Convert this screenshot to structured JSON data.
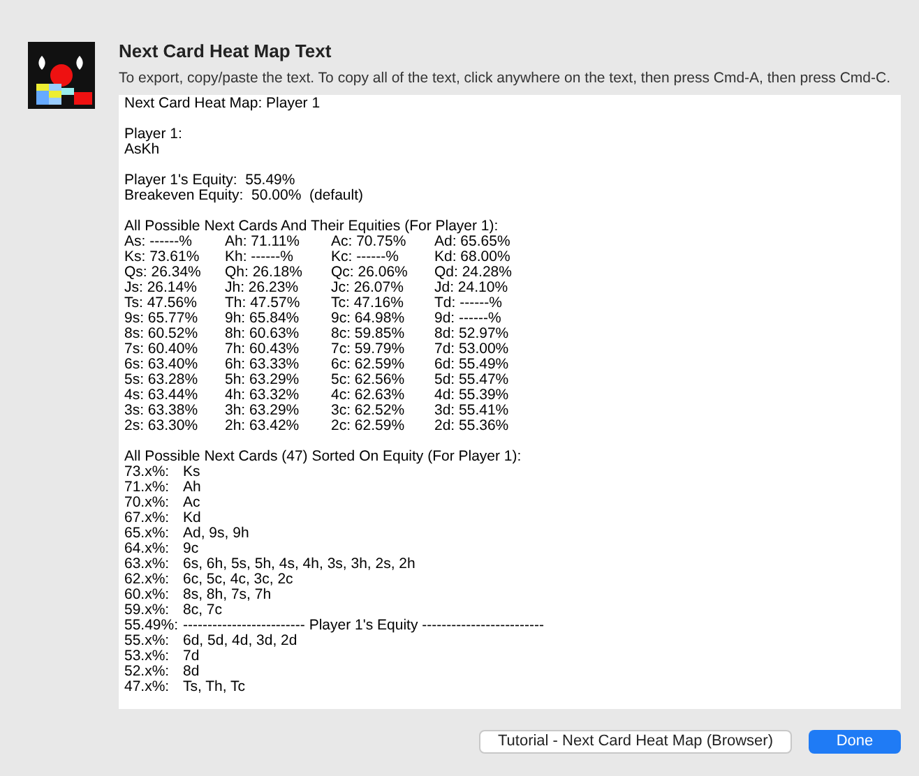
{
  "dialog": {
    "title": "Next Card Heat Map Text",
    "instructions": "To export, copy/paste the text. To copy all of the text, click anywhere on the text, then press Cmd-A, then press Cmd-C."
  },
  "report_lines": [
    {
      "kind": "text",
      "text": "Next Card Heat Map: Player 1"
    },
    {
      "kind": "blank"
    },
    {
      "kind": "text",
      "text": "Player 1:"
    },
    {
      "kind": "text",
      "text": "AsKh"
    },
    {
      "kind": "blank"
    },
    {
      "kind": "text",
      "text": "Player 1's Equity:  55.49%"
    },
    {
      "kind": "text",
      "text": "Breakeven Equity:  50.00%  (default)"
    },
    {
      "kind": "blank"
    },
    {
      "kind": "text",
      "text": "All Possible Next Cards And Their Equities (For Player 1):"
    },
    {
      "kind": "cells",
      "cells": [
        "As: ------%",
        "Ah: 71.11%",
        "Ac: 70.75%",
        "Ad: 65.65%"
      ]
    },
    {
      "kind": "cells",
      "cells": [
        "Ks: 73.61%",
        "Kh: ------%",
        "Kc: ------%",
        "Kd: 68.00%"
      ]
    },
    {
      "kind": "cells",
      "cells": [
        "Qs: 26.34%",
        "Qh: 26.18%",
        "Qc: 26.06%",
        "Qd: 24.28%"
      ]
    },
    {
      "kind": "cells",
      "cells": [
        "Js: 26.14%",
        "Jh: 26.23%",
        "Jc: 26.07%",
        "Jd: 24.10%"
      ]
    },
    {
      "kind": "cells",
      "cells": [
        "Ts: 47.56%",
        "Th: 47.57%",
        "Tc: 47.16%",
        "Td: ------%"
      ]
    },
    {
      "kind": "cells",
      "cells": [
        "9s: 65.77%",
        "9h: 65.84%",
        "9c: 64.98%",
        "9d: ------%"
      ]
    },
    {
      "kind": "cells",
      "cells": [
        "8s: 60.52%",
        "8h: 60.63%",
        "8c: 59.85%",
        "8d: 52.97%"
      ]
    },
    {
      "kind": "cells",
      "cells": [
        "7s: 60.40%",
        "7h: 60.43%",
        "7c: 59.79%",
        "7d: 53.00%"
      ]
    },
    {
      "kind": "cells",
      "cells": [
        "6s: 63.40%",
        "6h: 63.33%",
        "6c: 62.59%",
        "6d: 55.49%"
      ]
    },
    {
      "kind": "cells",
      "cells": [
        "5s: 63.28%",
        "5h: 63.29%",
        "5c: 62.56%",
        "5d: 55.47%"
      ]
    },
    {
      "kind": "cells",
      "cells": [
        "4s: 63.44%",
        "4h: 63.32%",
        "4c: 62.63%",
        "4d: 55.39%"
      ]
    },
    {
      "kind": "cells",
      "cells": [
        "3s: 63.38%",
        "3h: 63.29%",
        "3c: 62.52%",
        "3d: 55.41%"
      ]
    },
    {
      "kind": "cells",
      "cells": [
        "2s: 63.30%",
        "2h: 63.42%",
        "2c: 62.59%",
        "2d: 55.36%"
      ]
    },
    {
      "kind": "blank"
    },
    {
      "kind": "text",
      "text": "All Possible Next Cards (47) Sorted On Equity (For Player 1):"
    },
    {
      "kind": "sorted",
      "key": "73.x%:",
      "value": "Ks"
    },
    {
      "kind": "sorted",
      "key": "71.x%:",
      "value": "Ah"
    },
    {
      "kind": "sorted",
      "key": "70.x%:",
      "value": "Ac"
    },
    {
      "kind": "sorted",
      "key": "67.x%:",
      "value": "Kd"
    },
    {
      "kind": "sorted",
      "key": "65.x%:",
      "value": "Ad, 9s, 9h"
    },
    {
      "kind": "sorted",
      "key": "64.x%:",
      "value": "9c"
    },
    {
      "kind": "sorted",
      "key": "63.x%:",
      "value": "6s, 6h, 5s, 5h, 4s, 4h, 3s, 3h, 2s, 2h"
    },
    {
      "kind": "sorted",
      "key": "62.x%:",
      "value": "6c, 5c, 4c, 3c, 2c"
    },
    {
      "kind": "sorted",
      "key": "60.x%:",
      "value": "8s, 8h, 7s, 7h"
    },
    {
      "kind": "sorted",
      "key": "59.x%:",
      "value": "8c, 7c"
    },
    {
      "kind": "sorted",
      "key": "55.49%:",
      "value": "------------------------- Player 1's Equity -------------------------"
    },
    {
      "kind": "sorted",
      "key": "55.x%:",
      "value": "6d, 5d, 4d, 3d, 2d"
    },
    {
      "kind": "sorted",
      "key": "53.x%:",
      "value": "7d"
    },
    {
      "kind": "sorted",
      "key": "52.x%:",
      "value": "8d"
    },
    {
      "kind": "sorted",
      "key": "47.x%:",
      "value": "Ts, Th, Tc"
    }
  ],
  "buttons": [
    {
      "label": "Tutorial - Next Card Heat Map (Browser)",
      "kind": "secondary"
    },
    {
      "label": "Done",
      "kind": "primary"
    }
  ]
}
